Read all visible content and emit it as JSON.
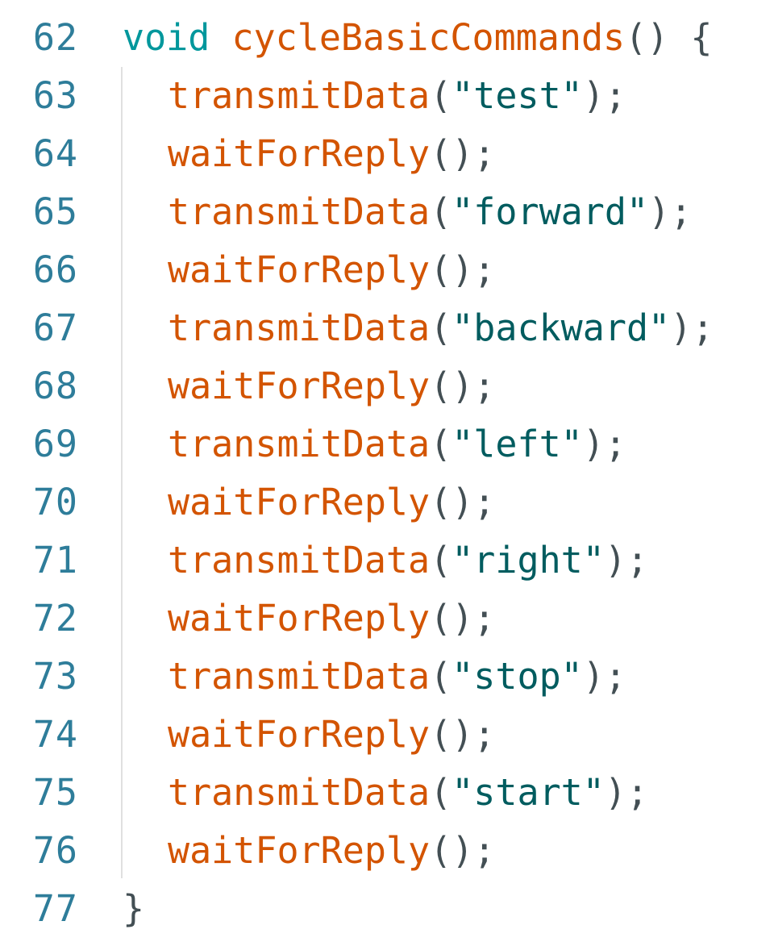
{
  "editor": {
    "colors": {
      "line_number": "#2e7d9a",
      "keyword": "#00979c",
      "function": "#d35400",
      "punctuation": "#434f54",
      "string": "#005c5f",
      "background": "#ffffff"
    },
    "lines": [
      {
        "number": "62",
        "indent": false,
        "tokens": [
          {
            "t": "kw",
            "v": "void"
          },
          {
            "t": "pn",
            "v": " "
          },
          {
            "t": "fn",
            "v": "cycleBasicCommands"
          },
          {
            "t": "pn",
            "v": "() {"
          }
        ]
      },
      {
        "number": "63",
        "indent": true,
        "tokens": [
          {
            "t": "fn",
            "v": "transmitData"
          },
          {
            "t": "pn",
            "v": "("
          },
          {
            "t": "str",
            "v": "\"test\""
          },
          {
            "t": "pn",
            "v": ");"
          }
        ]
      },
      {
        "number": "64",
        "indent": true,
        "tokens": [
          {
            "t": "fn",
            "v": "waitForReply"
          },
          {
            "t": "pn",
            "v": "();"
          }
        ]
      },
      {
        "number": "65",
        "indent": true,
        "tokens": [
          {
            "t": "fn",
            "v": "transmitData"
          },
          {
            "t": "pn",
            "v": "("
          },
          {
            "t": "str",
            "v": "\"forward\""
          },
          {
            "t": "pn",
            "v": ");"
          }
        ]
      },
      {
        "number": "66",
        "indent": true,
        "tokens": [
          {
            "t": "fn",
            "v": "waitForReply"
          },
          {
            "t": "pn",
            "v": "();"
          }
        ]
      },
      {
        "number": "67",
        "indent": true,
        "tokens": [
          {
            "t": "fn",
            "v": "transmitData"
          },
          {
            "t": "pn",
            "v": "("
          },
          {
            "t": "str",
            "v": "\"backward\""
          },
          {
            "t": "pn",
            "v": ");"
          }
        ]
      },
      {
        "number": "68",
        "indent": true,
        "tokens": [
          {
            "t": "fn",
            "v": "waitForReply"
          },
          {
            "t": "pn",
            "v": "();"
          }
        ]
      },
      {
        "number": "69",
        "indent": true,
        "tokens": [
          {
            "t": "fn",
            "v": "transmitData"
          },
          {
            "t": "pn",
            "v": "("
          },
          {
            "t": "str",
            "v": "\"left\""
          },
          {
            "t": "pn",
            "v": ");"
          }
        ]
      },
      {
        "number": "70",
        "indent": true,
        "tokens": [
          {
            "t": "fn",
            "v": "waitForReply"
          },
          {
            "t": "pn",
            "v": "();"
          }
        ]
      },
      {
        "number": "71",
        "indent": true,
        "tokens": [
          {
            "t": "fn",
            "v": "transmitData"
          },
          {
            "t": "pn",
            "v": "("
          },
          {
            "t": "str",
            "v": "\"right\""
          },
          {
            "t": "pn",
            "v": ");"
          }
        ]
      },
      {
        "number": "72",
        "indent": true,
        "tokens": [
          {
            "t": "fn",
            "v": "waitForReply"
          },
          {
            "t": "pn",
            "v": "();"
          }
        ]
      },
      {
        "number": "73",
        "indent": true,
        "tokens": [
          {
            "t": "fn",
            "v": "transmitData"
          },
          {
            "t": "pn",
            "v": "("
          },
          {
            "t": "str",
            "v": "\"stop\""
          },
          {
            "t": "pn",
            "v": ");"
          }
        ]
      },
      {
        "number": "74",
        "indent": true,
        "tokens": [
          {
            "t": "fn",
            "v": "waitForReply"
          },
          {
            "t": "pn",
            "v": "();"
          }
        ]
      },
      {
        "number": "75",
        "indent": true,
        "tokens": [
          {
            "t": "fn",
            "v": "transmitData"
          },
          {
            "t": "pn",
            "v": "("
          },
          {
            "t": "str",
            "v": "\"start\""
          },
          {
            "t": "pn",
            "v": ");"
          }
        ]
      },
      {
        "number": "76",
        "indent": true,
        "tokens": [
          {
            "t": "fn",
            "v": "waitForReply"
          },
          {
            "t": "pn",
            "v": "();"
          }
        ]
      },
      {
        "number": "77",
        "indent": false,
        "tokens": [
          {
            "t": "pn",
            "v": "}"
          }
        ]
      }
    ]
  }
}
